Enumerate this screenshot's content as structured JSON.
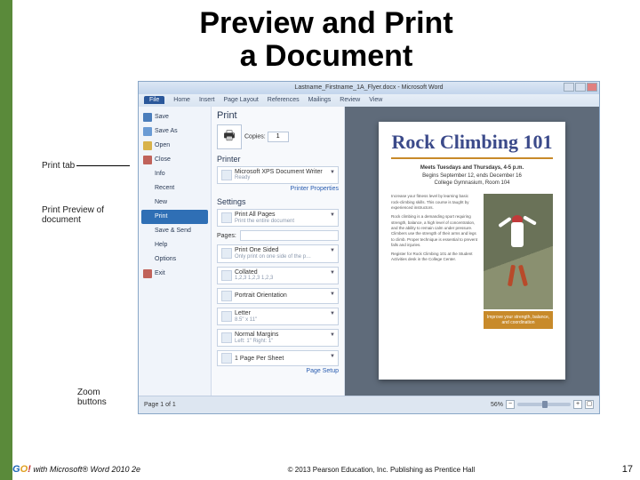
{
  "slide": {
    "title": "Preview and Print\na Document"
  },
  "callouts": {
    "print_tab": "Print tab",
    "preview": "Print Preview of document",
    "zoom": "Zoom buttons"
  },
  "window": {
    "title": "Lastname_Firstname_1A_Flyer.docx - Microsoft Word"
  },
  "ribbon": {
    "file": "File",
    "tabs": [
      "Home",
      "Insert",
      "Page Layout",
      "References",
      "Mailings",
      "Review",
      "View"
    ]
  },
  "nav": {
    "save": "Save",
    "save_as": "Save As",
    "open": "Open",
    "close": "Close",
    "info": "Info",
    "recent": "Recent",
    "new": "New",
    "print": "Print",
    "save_send": "Save & Send",
    "help": "Help",
    "options": "Options",
    "exit": "Exit"
  },
  "print": {
    "heading": "Print",
    "copies_label": "Copies:",
    "copies_value": "1",
    "printer_head": "Printer",
    "printer_name": "Microsoft XPS Document Writer",
    "printer_status": "Ready",
    "printer_props": "Printer Properties",
    "settings_head": "Settings",
    "scope_main": "Print All Pages",
    "scope_sub": "Print the entire document",
    "pages_label": "Pages:",
    "pages_placeholder": "",
    "sided_main": "Print One Sided",
    "sided_sub": "Only print on one side of the p…",
    "collated_main": "Collated",
    "collated_sub": "1,2,3   1,2,3   1,2,3",
    "orient_main": "Portrait Orientation",
    "size_main": "Letter",
    "size_sub": "8.5\" x 11\"",
    "margins_main": "Normal Margins",
    "margins_sub": "Left: 1\"   Right: 1\"",
    "sheet_main": "1 Page Per Sheet",
    "page_setup": "Page Setup"
  },
  "preview_doc": {
    "heading": "Rock Climbing 101",
    "meta1": "Meets Tuesdays and Thursdays, 4-5 p.m.",
    "meta2": "Begins September 12, ends December 16",
    "meta3": "College Gymnasium, Room 104",
    "caption": "Improve your strength, balance, and coordination"
  },
  "statusbar": {
    "page": "Page 1 of 1",
    "zoom_pct": "56%"
  },
  "footer": {
    "product": "with Microsoft® Word 2010 2e",
    "copyright": "© 2013 Pearson Education, Inc. Publishing as Prentice Hall",
    "page_no": "17"
  }
}
